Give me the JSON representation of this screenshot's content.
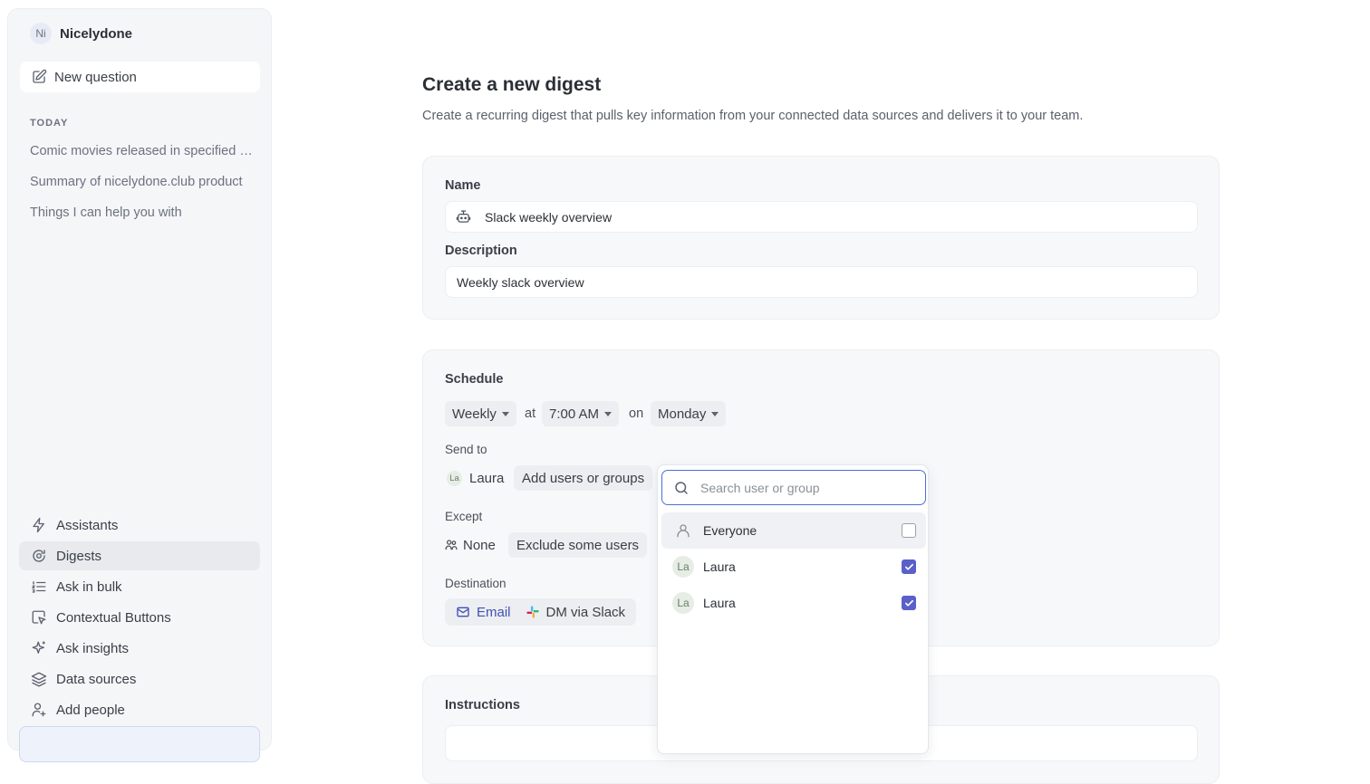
{
  "workspace": {
    "initials": "Ni",
    "name": "Nicelydone"
  },
  "sidebar": {
    "new_question": "New question",
    "section_today": "TODAY",
    "history": [
      "Comic movies released in specified d...",
      "Summary of nicelydone.club product",
      "Things I can help you with"
    ],
    "nav": [
      {
        "label": "Assistants",
        "icon": "lightning-icon"
      },
      {
        "label": "Digests",
        "icon": "digest-icon",
        "active": true
      },
      {
        "label": "Ask in bulk",
        "icon": "numbered-list-icon"
      },
      {
        "label": "Contextual Buttons",
        "icon": "cursor-click-icon"
      },
      {
        "label": "Ask insights",
        "icon": "sparkles-icon"
      },
      {
        "label": "Data sources",
        "icon": "layers-icon"
      },
      {
        "label": "Add people",
        "icon": "add-user-icon"
      }
    ]
  },
  "page": {
    "title": "Create a new digest",
    "subtitle": "Create a recurring digest that pulls key information from your connected data sources and delivers it to your team."
  },
  "form": {
    "name_label": "Name",
    "name_value": "Slack weekly overview",
    "description_label": "Description",
    "description_value": "Weekly slack overview"
  },
  "schedule": {
    "label": "Schedule",
    "frequency": "Weekly",
    "at_word": "at",
    "time": "7:00 AM",
    "on_word": "on",
    "day": "Monday",
    "send_to_label": "Send to",
    "recipient": {
      "initials": "La",
      "name": "Laura"
    },
    "add_users_button": "Add users or groups",
    "except_label": "Except",
    "except_value": "None",
    "exclude_button": "Exclude some users",
    "destination_label": "Destination",
    "destinations": [
      {
        "label": "Email",
        "icon": "mail-icon",
        "active": true
      },
      {
        "label": "DM via Slack",
        "icon": "slack-icon",
        "active": false
      }
    ]
  },
  "instructions": {
    "label": "Instructions"
  },
  "dropdown": {
    "search_placeholder": "Search user or group",
    "options": [
      {
        "label": "Everyone",
        "icon": "user-outline-icon",
        "checked": false
      },
      {
        "label": "Laura",
        "initials": "La",
        "checked": true
      },
      {
        "label": "Laura",
        "initials": "La",
        "checked": true
      }
    ]
  },
  "colors": {
    "accent": "#5a5fc9",
    "focus": "#4c6fd6",
    "active_link": "#3f51b5"
  }
}
